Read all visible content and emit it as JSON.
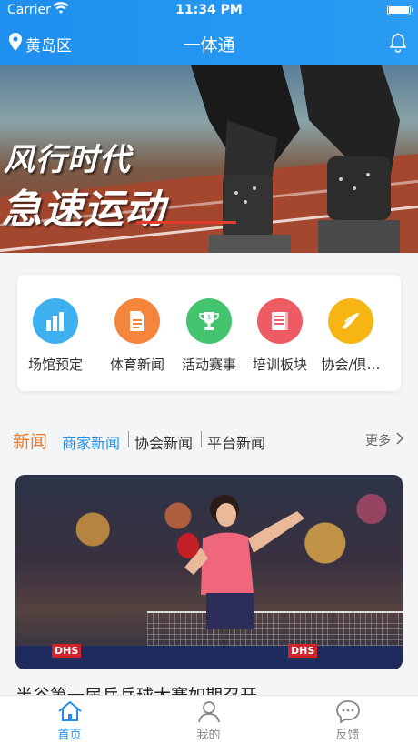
{
  "status_bar": {
    "carrier": "Carrier",
    "time": "11:34 PM"
  },
  "nav": {
    "location": "黄岛区",
    "title": "一体通"
  },
  "banner": {
    "line1": "风行时代",
    "line2": "急速运动"
  },
  "menu": [
    {
      "label": "场馆预定",
      "icon": "stadium-icon",
      "color": "#3fb0ef"
    },
    {
      "label": "体育新闻",
      "icon": "news-document-icon",
      "color": "#f5843c"
    },
    {
      "label": "活动赛事",
      "icon": "trophy-icon",
      "color": "#44c46e"
    },
    {
      "label": "培训板块",
      "icon": "training-book-icon",
      "color": "#ef5b63"
    },
    {
      "label": "协会/俱…",
      "icon": "association-icon",
      "color": "#f7b514"
    }
  ],
  "news": {
    "title": "新闻",
    "tabs": [
      "商家新闻",
      "协会新闻",
      "平台新闻"
    ],
    "active_tab_color": "#1f8ff0",
    "more": "更多",
    "article_title": "半谷第一届乒乓球大赛如期召开",
    "photo_labels": [
      "DHS",
      "DHS"
    ]
  },
  "tabbar": [
    {
      "label": "首页",
      "icon": "home-icon",
      "active": true
    },
    {
      "label": "我的",
      "icon": "profile-icon",
      "active": false
    },
    {
      "label": "反馈",
      "icon": "feedback-chat-icon",
      "active": false
    }
  ],
  "colors": {
    "primary": "#1f8ff0",
    "accent": "#f07b22"
  }
}
